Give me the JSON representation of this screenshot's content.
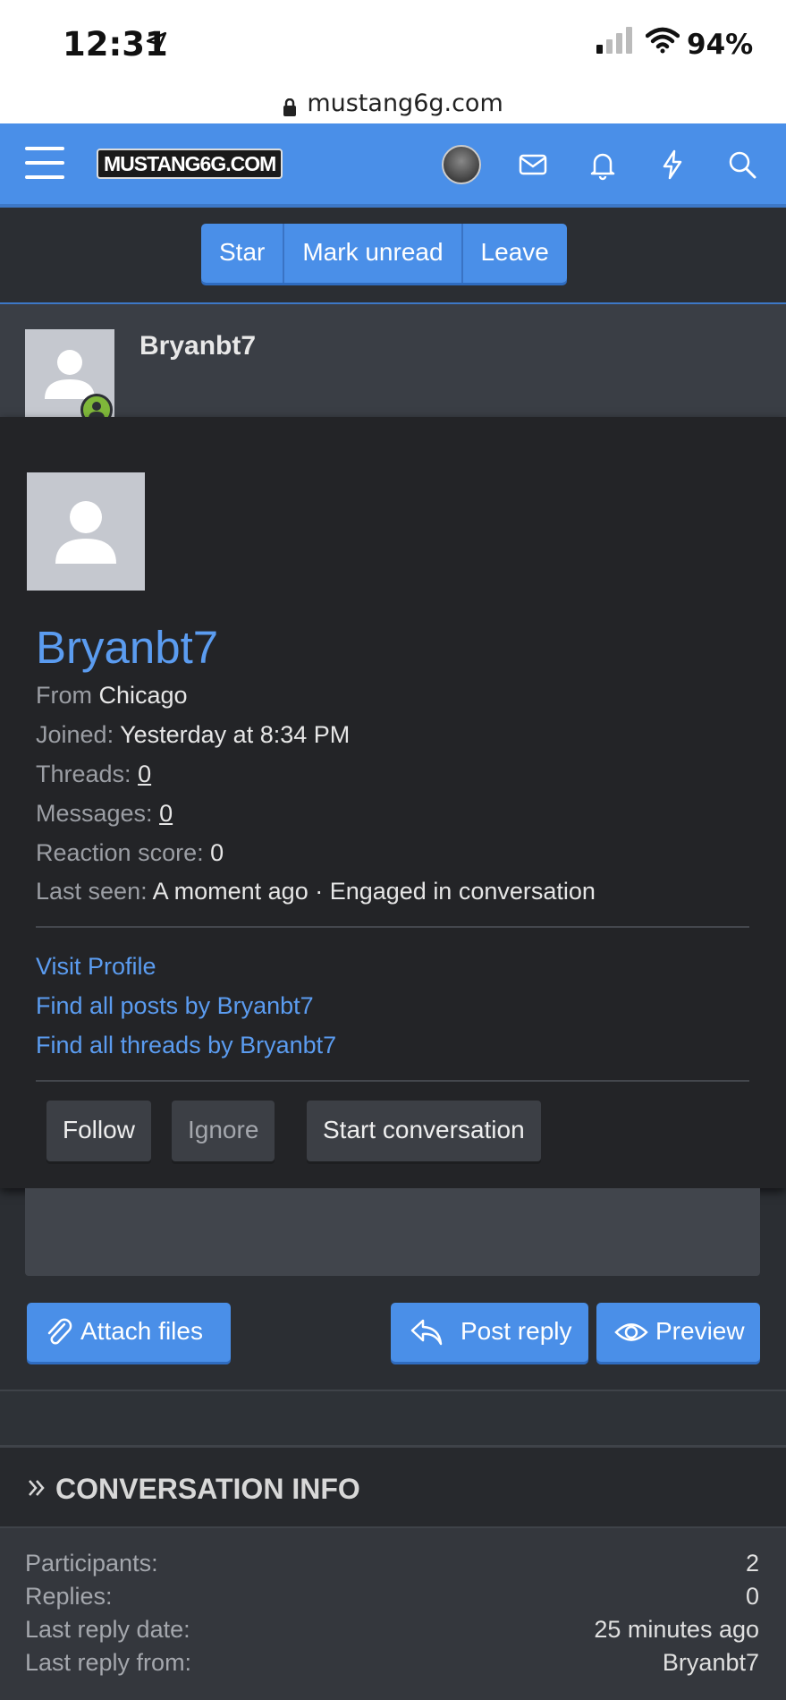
{
  "status": {
    "time": "12:31",
    "battery": "94%"
  },
  "browser": {
    "url": "mustang6g.com"
  },
  "header": {
    "logo_text": "MUSTANG6G.COM"
  },
  "conversation_actions": [
    "Star",
    "Mark unread",
    "Leave"
  ],
  "message": {
    "author": "Bryanbt7"
  },
  "member_card": {
    "name": "Bryanbt7",
    "from_label": "From",
    "from_value": "Chicago",
    "joined_label": "Joined:",
    "joined_value": "Yesterday at 8:34 PM",
    "threads_label": "Threads:",
    "threads_value": "0",
    "messages_label": "Messages:",
    "messages_value": "0",
    "reaction_label": "Reaction score:",
    "reaction_value": "0",
    "last_seen_label": "Last seen:",
    "last_seen_value": "A moment ago · Engaged in conversation",
    "links": {
      "visit_profile": "Visit Profile",
      "find_posts": "Find all posts by Bryanbt7",
      "find_threads": "Find all threads by Bryanbt7"
    },
    "buttons": {
      "follow": "Follow",
      "ignore": "Ignore",
      "start_conversation": "Start conversation"
    }
  },
  "editor": {
    "attach_label": "Attach files",
    "post_reply_label": "Post reply",
    "preview_label": "Preview"
  },
  "conversation_info": {
    "title": "CONVERSATION INFO",
    "rows": [
      {
        "label": "Participants:",
        "value": "2"
      },
      {
        "label": "Replies:",
        "value": "0"
      },
      {
        "label": "Last reply date:",
        "value": "25 minutes ago"
      },
      {
        "label": "Last reply from:",
        "value": "Bryanbt7"
      }
    ]
  },
  "colors": {
    "accent": "#4a8fe8",
    "link": "#5b9cf0",
    "online": "#7fb83a",
    "background": "#2b2e33"
  },
  "icons": [
    "location-arrow-icon",
    "signal-icon",
    "wifi-icon",
    "lock-icon",
    "menu-icon",
    "mail-icon",
    "bell-icon",
    "lightning-icon",
    "search-icon",
    "user-placeholder-icon",
    "online-status-icon",
    "paperclip-icon",
    "reply-icon",
    "eye-icon",
    "chevron-double-right-icon"
  ]
}
